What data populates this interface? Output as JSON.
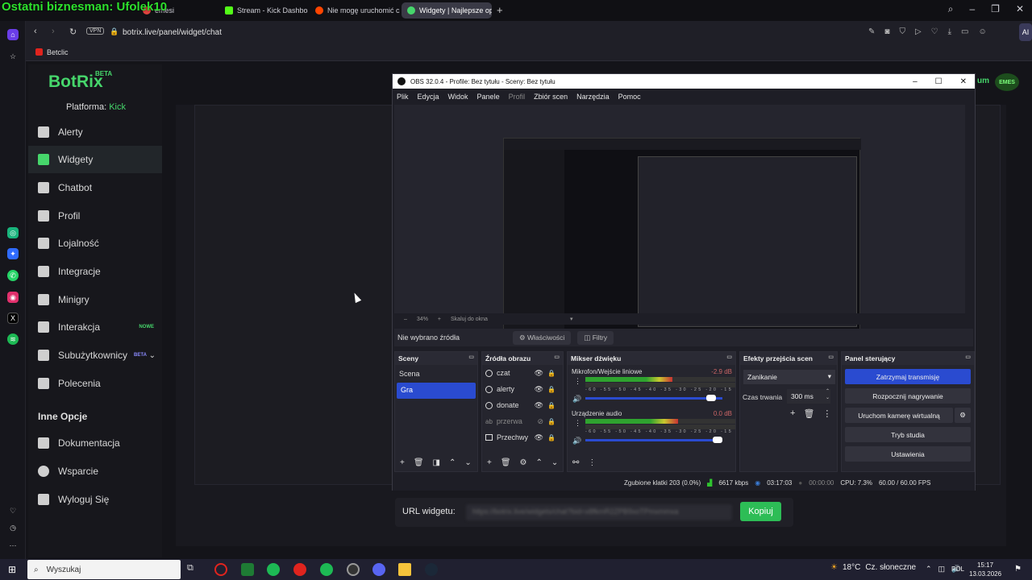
{
  "overlay_title": "Ostatni biznesman: Ufolek10",
  "browser": {
    "tabs": [
      {
        "label": "emesi",
        "color": "#e0443e"
      },
      {
        "label": "Stream - Kick Dashboard",
        "color": "#53fc18"
      },
      {
        "label": "Nie mogę uruchomić czat",
        "color": "#ff4500"
      },
      {
        "label": "Widgety | Najlepsze oprogr",
        "color": "#46d66b"
      }
    ],
    "url": "botrix.live/panel/widget/chat",
    "vpn_label": "VPN",
    "bookmark": "Betclic",
    "ai_label": "AI"
  },
  "botrix": {
    "logo": "BotRix",
    "beta": "BETA",
    "platform_label": "Platforma:",
    "platform_value": "Kick",
    "nav": [
      {
        "label": "Alerty",
        "active": false
      },
      {
        "label": "Widgety",
        "active": true
      },
      {
        "label": "Chatbot",
        "active": false
      },
      {
        "label": "Profil",
        "active": false
      },
      {
        "label": "Lojalność",
        "active": false
      },
      {
        "label": "Integracje",
        "active": false
      },
      {
        "label": "Minigry",
        "active": false
      },
      {
        "label": "Interakcja",
        "badge": "NOWE"
      },
      {
        "label": "Subużytkownicy",
        "badge": "BETA"
      },
      {
        "label": "Polecenia",
        "active": false
      }
    ],
    "section_other": "Inne Opcje",
    "nav2": [
      {
        "label": "Dokumentacja"
      },
      {
        "label": "Wsparcie"
      },
      {
        "label": "Wyloguj Się"
      }
    ],
    "url_label": "URL widgetu:",
    "url_value": "https://botrix.live/widgets/chat?bid=x8fkmR2ZPB9xoTPmxmmxa",
    "copy_button": "Kopiuj",
    "premium_suffix": "um",
    "emes_badge": "EMES"
  },
  "obs": {
    "title": "OBS 32.0.4 - Profile: Bez tytułu - Sceny: Bez tytułu",
    "menu": [
      "Plik",
      "Edycja",
      "Widok",
      "Panele",
      "Profil",
      "Zbiór scen",
      "Narzędzia",
      "Pomoc"
    ],
    "zoom": "34%",
    "scale_label": "Skaluj do okna",
    "no_source": "Nie wybrano źródła",
    "properties_btn": "Właściwości",
    "filters_btn": "Filtry",
    "docks": {
      "scenes": {
        "title": "Sceny",
        "items": [
          "Scena",
          "Gra"
        ],
        "selected": "Gra"
      },
      "sources": {
        "title": "Źródła obrazu",
        "items": [
          "czat",
          "alerty",
          "donate",
          "przerwa",
          "Przechwy"
        ]
      },
      "mixer": {
        "title": "Mikser dźwięku",
        "channels": [
          {
            "name": "Mikrofon/Wejście liniowe",
            "db": "-2.9 dB",
            "level": 0.58,
            "volume": 0.95
          },
          {
            "name": "Urządzenie audio",
            "db": "0.0 dB",
            "level": 0.62,
            "volume": 1.0
          }
        ],
        "scale": "-60 -55 -50 -45 -40 -35 -30 -25 -20 -15 -10 -5 0"
      },
      "transitions": {
        "title": "Efekty przejścia scen",
        "type": "Zanikanie",
        "duration_label": "Czas trwania",
        "duration": "300 ms"
      },
      "controls": {
        "title": "Panel sterujący",
        "buttons": [
          "Zatrzymaj transmisję",
          "Rozpocznij nagrywanie",
          "Uruchom kamerę wirtualną",
          "Tryb studia",
          "Ustawienia"
        ]
      }
    },
    "status": {
      "dropped": "Zgubione klatki 203 (0.0%)",
      "bitrate": "6617 kbps",
      "stream_time": "03:17:03",
      "rec_time": "00:00:00",
      "cpu": "CPU: 7.3%",
      "fps": "60.00 / 60.00 FPS"
    }
  },
  "taskbar": {
    "search": "Wyszukaj",
    "weather": "18°C",
    "weather_desc": "Cz. słoneczne",
    "lang": "POL",
    "time": "15:17",
    "date": "13.03.2026"
  }
}
